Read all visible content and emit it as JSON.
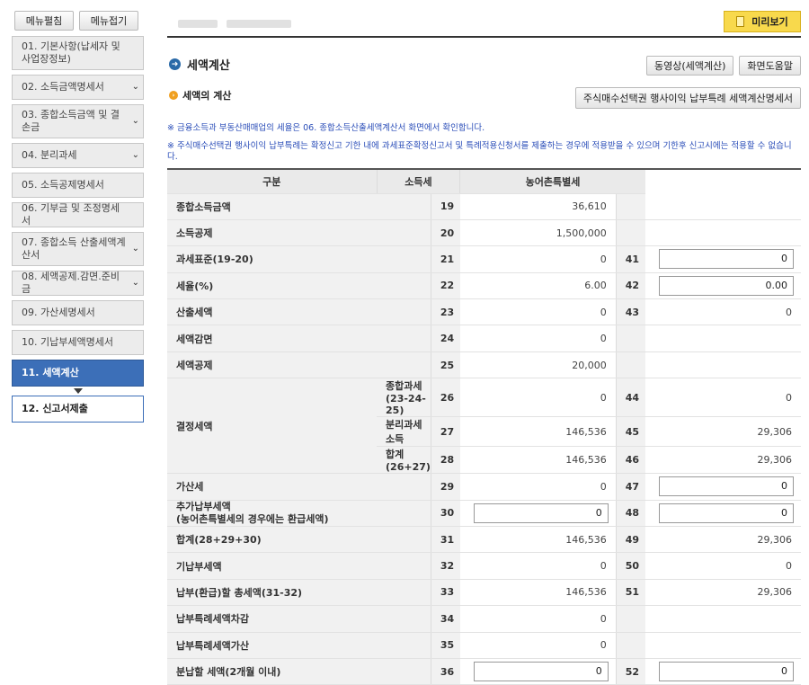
{
  "top_buttons": {
    "expand": "메뉴펼침",
    "collapse": "메뉴접기"
  },
  "sidebar": {
    "items": [
      {
        "label": "01. 기본사항(납세자 및 사업장정보)",
        "chev": false,
        "state": "normal"
      },
      {
        "label": "02. 소득금액명세서",
        "chev": true,
        "state": "normal"
      },
      {
        "label": "03. 종합소득금액 및 결손금",
        "chev": true,
        "state": "normal"
      },
      {
        "label": "04. 분리과세",
        "chev": true,
        "state": "normal"
      },
      {
        "label": "05. 소득공제명세서",
        "chev": false,
        "state": "normal"
      },
      {
        "label": "06. 기부금 및 조정명세서",
        "chev": false,
        "state": "normal"
      },
      {
        "label": "07. 종합소득 산출세액계산서",
        "chev": true,
        "state": "normal"
      },
      {
        "label": "08. 세액공제.감면.준비금",
        "chev": true,
        "state": "normal"
      },
      {
        "label": "09. 가산세명세서",
        "chev": false,
        "state": "normal"
      },
      {
        "label": "10. 기납부세액명세서",
        "chev": false,
        "state": "normal"
      },
      {
        "label": "11. 세액계산",
        "chev": false,
        "state": "active"
      },
      {
        "label": "12. 신고서제출",
        "chev": false,
        "state": "next"
      }
    ]
  },
  "header": {
    "preview_label": "미리보기"
  },
  "section": {
    "title": "세액계산",
    "video_button": "동영상(세액계산)",
    "help_button": "화면도움말",
    "subtitle": "세액의 계산",
    "stock_option_button": "주식매수선택권 행사이익 납부특례 세액계산명세서"
  },
  "notes": [
    "※ 금융소득과 부동산매매업의 세율은 06. 종합소득산출세액계산서 화면에서 확인합니다.",
    "※ 주식매수선택권 행사이익 납부특례는 확정신고 기한 내에 과세표준확정신고서 및 특례적용신청서를 제출하는 경우에 적용받을 수 있으며 기한후 신고시에는 적용할 수 없습니다."
  ],
  "table": {
    "headers": {
      "category": "구분",
      "income_tax": "소득세",
      "rural_tax": "농어촌특별세"
    },
    "group_label": "결정세액",
    "rows": [
      {
        "label": "종합소득금액",
        "n1": "19",
        "v1": "36,610",
        "n2": "",
        "v2": "",
        "input1": false,
        "input2": false
      },
      {
        "label": "소득공제",
        "n1": "20",
        "v1": "1,500,000",
        "n2": "",
        "v2": "",
        "input1": false,
        "input2": false
      },
      {
        "label": "과세표준(19-20)",
        "n1": "21",
        "v1": "0",
        "n2": "41",
        "v2": "0",
        "input1": false,
        "input2": true
      },
      {
        "label": "세율(%)",
        "n1": "22",
        "v1": "6.00",
        "n2": "42",
        "v2": "0.00",
        "input1": false,
        "input2": true
      },
      {
        "label": "산출세액",
        "n1": "23",
        "v1": "0",
        "n2": "43",
        "v2": "0",
        "input1": false,
        "input2": false
      },
      {
        "label": "세액감면",
        "n1": "24",
        "v1": "0",
        "n2": "",
        "v2": "",
        "input1": false,
        "input2": false
      },
      {
        "label": "세액공제",
        "n1": "25",
        "v1": "20,000",
        "n2": "",
        "v2": "",
        "input1": false,
        "input2": false
      },
      {
        "label": "종합과세(23-24-25)",
        "n1": "26",
        "v1": "0",
        "n2": "44",
        "v2": "0",
        "input1": false,
        "input2": false,
        "sub": true
      },
      {
        "label": "분리과세소득",
        "n1": "27",
        "v1": "146,536",
        "n2": "45",
        "v2": "29,306",
        "input1": false,
        "input2": false,
        "sub": true
      },
      {
        "label": "합계(26+27)",
        "n1": "28",
        "v1": "146,536",
        "n2": "46",
        "v2": "29,306",
        "input1": false,
        "input2": false,
        "sub": true
      },
      {
        "label": "가산세",
        "n1": "29",
        "v1": "0",
        "n2": "47",
        "v2": "0",
        "input1": false,
        "input2": true
      },
      {
        "label": "추가납부세액\n(농어촌특별세의 경우에는 환급세액)",
        "n1": "30",
        "v1": "0",
        "n2": "48",
        "v2": "0",
        "input1": true,
        "input2": true
      },
      {
        "label": "합계(28+29+30)",
        "n1": "31",
        "v1": "146,536",
        "n2": "49",
        "v2": "29,306",
        "input1": false,
        "input2": false
      },
      {
        "label": "기납부세액",
        "n1": "32",
        "v1": "0",
        "n2": "50",
        "v2": "0",
        "input1": false,
        "input2": false
      },
      {
        "label": "납부(환급)할 총세액(31-32)",
        "n1": "33",
        "v1": "146,536",
        "n2": "51",
        "v2": "29,306",
        "input1": false,
        "input2": false
      },
      {
        "label": "납부특례세액차감",
        "n1": "34",
        "v1": "0",
        "n2": "",
        "v2": "",
        "input1": false,
        "input2": false
      },
      {
        "label": "납부특례세액가산",
        "n1": "35",
        "v1": "0",
        "n2": "",
        "v2": "",
        "input1": false,
        "input2": false
      },
      {
        "label": "분납할 세액(2개월 이내)",
        "n1": "36",
        "v1": "0",
        "n2": "52",
        "v2": "0",
        "input1": true,
        "input2": true
      }
    ]
  }
}
